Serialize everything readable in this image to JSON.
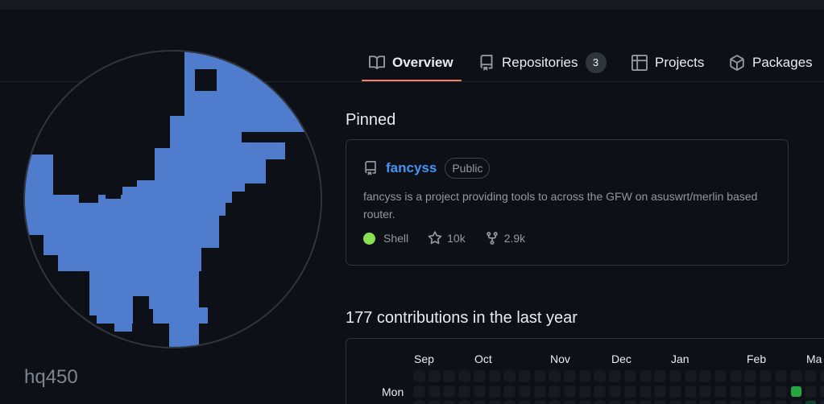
{
  "tabs": [
    {
      "label": "Overview",
      "icon": "book-icon",
      "selected": true
    },
    {
      "label": "Repositories",
      "icon": "repo-icon",
      "count": "3"
    },
    {
      "label": "Projects",
      "icon": "table-icon"
    },
    {
      "label": "Packages",
      "icon": "package-icon"
    }
  ],
  "profile": {
    "username": "hq450",
    "avatar": "pixel-dinosaur-avatar"
  },
  "pinned": {
    "title": "Pinned",
    "repo": {
      "name": "fancyss",
      "visibility": "Public",
      "description": "fancyss is a project providing tools to across the GFW on asuswrt/merlin based router.",
      "language": "Shell",
      "language_color": "#89e051",
      "stars": "10k",
      "forks": "2.9k"
    }
  },
  "contributions": {
    "title": "177 contributions in the last year",
    "months": [
      "Sep",
      "Oct",
      "Nov",
      "Dec",
      "Jan",
      "Feb",
      "Ma"
    ],
    "day_label": "Mon",
    "colors": {
      "empty": "#161b22",
      "level2": "#26a641"
    }
  },
  "colors": {
    "accent_underline": "#f78166",
    "link": "#4493f8",
    "avatar_blue": "#4f7ccd"
  }
}
